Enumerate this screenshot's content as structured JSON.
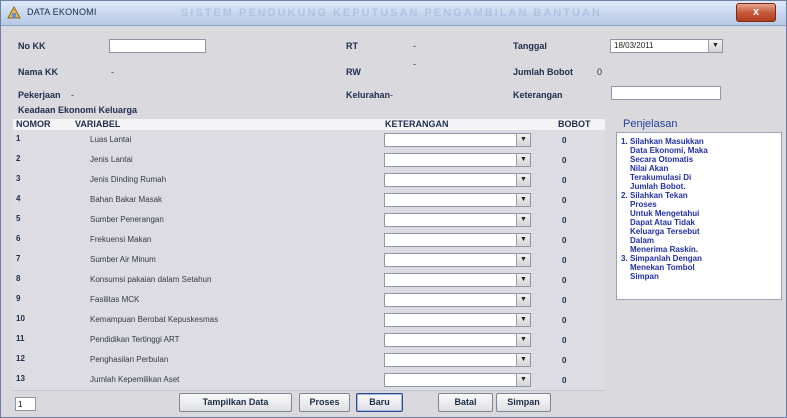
{
  "window": {
    "title": "DATA EKONOMI",
    "banner": "SISTEM PENDUKUNG KEPUTUSAN PENGAMBILAN BANTUAN",
    "close_glyph": "x"
  },
  "form": {
    "no_kk_label": "No KK",
    "no_kk_value": "",
    "nama_kk_label": "Nama KK",
    "nama_kk_value": "-",
    "pekerjaan_label": "Pekerjaan",
    "pekerjaan_value": "-",
    "rt_label": "RT",
    "rt_value": "-",
    "rw_label": "RW",
    "rw_value": "-",
    "kelurahan_label": "Kelurahan",
    "kelurahan_value": "-",
    "tanggal_label": "Tanggal",
    "tanggal_value": "18/03/2011",
    "jumlah_bobot_label": "Jumlah Bobot",
    "jumlah_bobot_value": "0",
    "keterangan_label": "Keterangan",
    "keterangan_value": ""
  },
  "section_title": "Keadaan Ekonomi Keluarga",
  "table": {
    "headers": {
      "nomor": "NOMOR",
      "variabel": "VARIABEL",
      "keterangan": "KETERANGAN",
      "bobot": "BOBOT"
    },
    "rows": [
      {
        "no": "1",
        "variabel": "Luas Lantai",
        "keterangan": "",
        "bobot": "0"
      },
      {
        "no": "2",
        "variabel": "Jenis Lantai",
        "keterangan": "",
        "bobot": "0"
      },
      {
        "no": "3",
        "variabel": "Jenis Dinding  Rumah",
        "keterangan": "",
        "bobot": "0"
      },
      {
        "no": "4",
        "variabel": "Bahan Bakar Masak",
        "keterangan": "",
        "bobot": "0"
      },
      {
        "no": "5",
        "variabel": "Sumber Penerangan",
        "keterangan": "",
        "bobot": "0"
      },
      {
        "no": "6",
        "variabel": "Frekuensi Makan",
        "keterangan": "",
        "bobot": "0"
      },
      {
        "no": "7",
        "variabel": "Sumber Air Minum",
        "keterangan": "",
        "bobot": "0"
      },
      {
        "no": "8",
        "variabel": "Konsumsi pakaian dalam Setahun",
        "keterangan": "",
        "bobot": "0"
      },
      {
        "no": "9",
        "variabel": "Fasilitas MCK",
        "keterangan": "",
        "bobot": "0"
      },
      {
        "no": "10",
        "variabel": "Kemampuan Berobat Kepuskesmas",
        "keterangan": "",
        "bobot": "0"
      },
      {
        "no": "11",
        "variabel": "Pendidikan Tertinggi ART",
        "keterangan": "",
        "bobot": "0"
      },
      {
        "no": "12",
        "variabel": "Penghasilan Perbulan",
        "keterangan": "",
        "bobot": "0"
      },
      {
        "no": "13",
        "variabel": "Jumlah Kepemilikan Aset",
        "keterangan": "",
        "bobot": "0"
      }
    ]
  },
  "penjelasan": {
    "title": "Penjelasan",
    "items": [
      {
        "n": "1.",
        "first": "Silahkan Masukkan",
        "rest": [
          "Data Ekonomi, Maka",
          "Secara Otomatis",
          "Nilai Akan",
          "Terakumulasi Di",
          "Jumlah Bobot."
        ]
      },
      {
        "n": "2.",
        "first": "Silahkan Tekan",
        "rest": [
          "Proses",
          "Untuk Mengetahui",
          "Dapat Atau Tidak",
          "Keluarga Tersebut",
          "Dalam",
          "Menerima Raskin."
        ]
      },
      {
        "n": "3.",
        "first": "Simpanlah Dengan",
        "rest": [
          "Menekan Tombol",
          "Simpan"
        ]
      }
    ]
  },
  "footer": {
    "counter_value": "1",
    "buttons": {
      "tampilkan": "Tampilkan Data",
      "proses": "Proses",
      "baru": "Baru",
      "batal": "Batal",
      "simpan": "Simpan"
    }
  }
}
